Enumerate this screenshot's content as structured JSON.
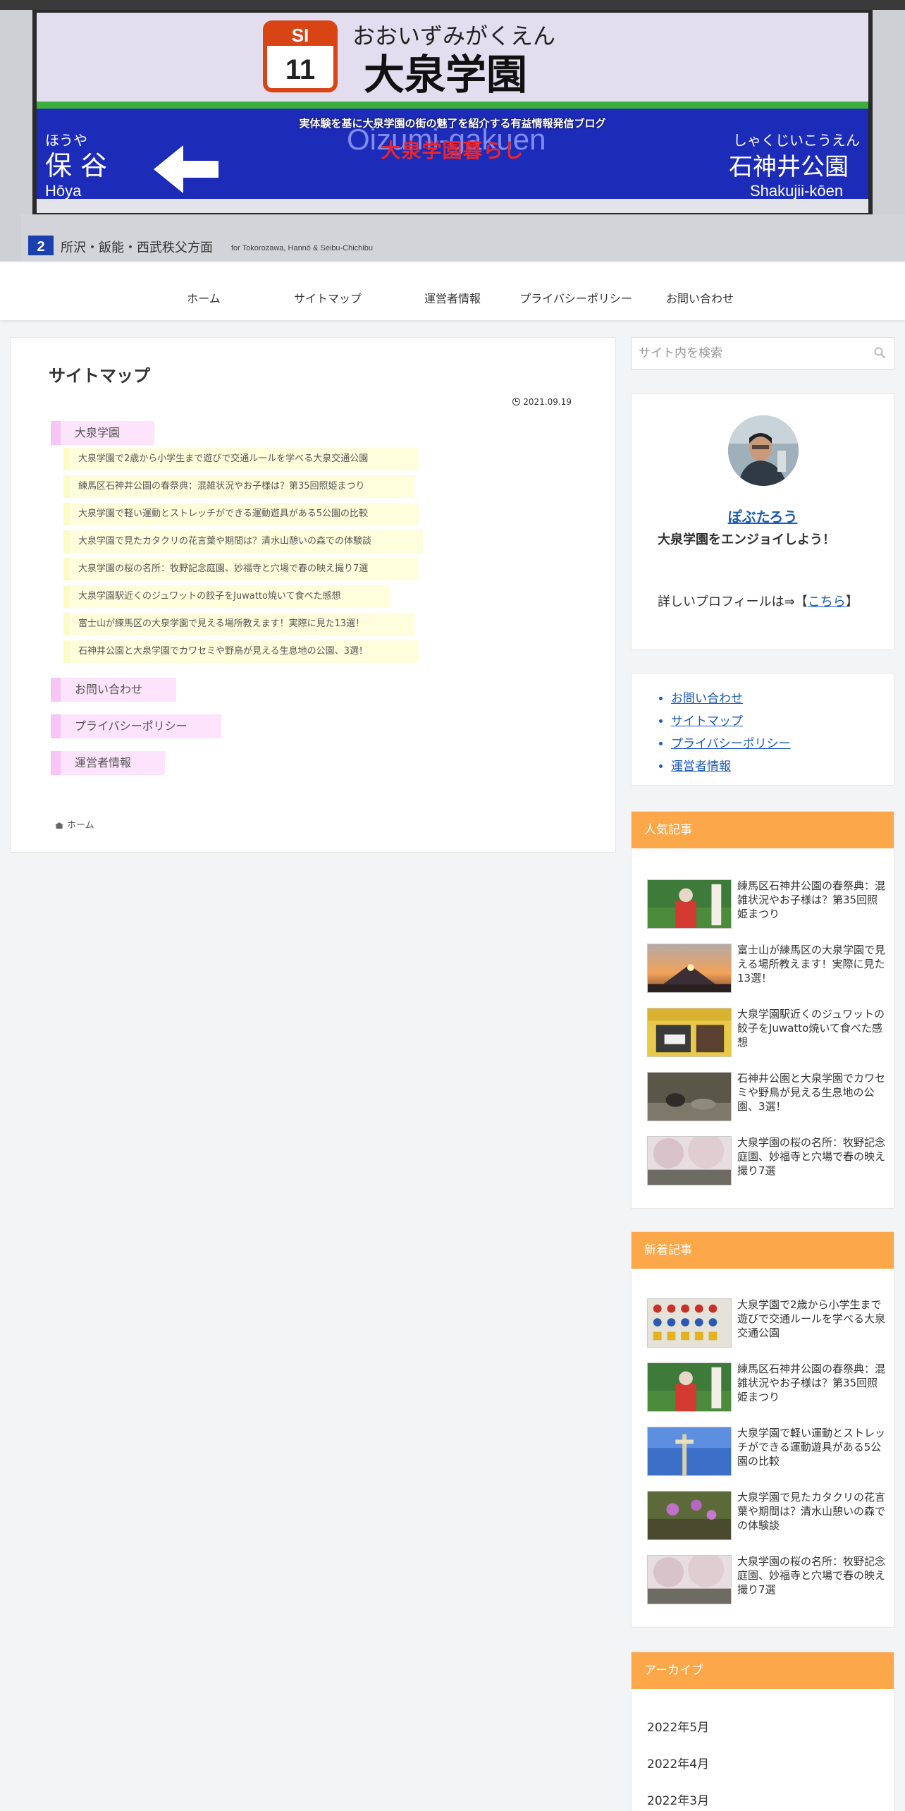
{
  "header": {
    "tagline": "実体験を基に大泉学園の街の魅了を紹介する有益情報発信ブログ",
    "site_title": "大泉学園暮らし",
    "photo_sign": {
      "station_number_line": "SI",
      "station_number": "11",
      "station_kana": "おおいずみがくえん",
      "station_kanji": "大泉学園",
      "station_roman": "Oizumi-gakuen",
      "left_kana": "ほうや",
      "left_kanji": "保 谷",
      "left_roman": "Hōya",
      "right_kana": "しゃくじいこうえん",
      "right_kanji": "石神井公園",
      "right_roman": "Shakujii-kōen",
      "platform_number": "2",
      "platform_text": "所沢・飯能・西武秩父方面",
      "platform_text_en": "for Tokorozawa, Hannō & Seibu-Chichibu"
    }
  },
  "nav": {
    "items": [
      "ホーム",
      "サイトマップ",
      "運営者情報",
      "プライバシーポリシー",
      "お問い合わせ"
    ]
  },
  "main": {
    "title": "サイトマップ",
    "date": "2021.09.19",
    "categories": [
      {
        "label": "大泉学園",
        "posts": [
          "大泉学園で2歳から小学生まで遊びで交通ルールを学べる大泉交通公園",
          "練馬区石神井公園の春祭典：混雑状況やお子様は？第35回照姫まつり",
          "大泉学園で軽い運動とストレッチができる運動遊具がある5公園の比較",
          "大泉学園で見たカタクリの花言葉や期間は？清水山憩いの森での体験談",
          "大泉学園の桜の名所：牧野記念庭園、妙福寺と穴場で春の映え撮り7選",
          "大泉学園駅近くのジュワットの餃子をJuwatto焼いて食べた感想",
          "富士山が練馬区の大泉学園で見える場所教えます！実際に見た13選！",
          "石神井公園と大泉学園でカワセミや野鳥が見える生息地の公園、3選！"
        ]
      }
    ],
    "pages": [
      "お問い合わせ",
      "プライバシーポリシー",
      "運営者情報"
    ],
    "breadcrumb": "ホーム"
  },
  "sidebar": {
    "search_placeholder": "サイト内を検索",
    "profile": {
      "name": "ぽぶたろう",
      "message": "大泉学園をエンジョイしよう！",
      "more_prefix": "詳しいプロフィールは⇒【",
      "more_link": "こちら",
      "more_suffix": "】"
    },
    "links": [
      "お問い合わせ",
      "サイトマップ",
      "プライバシーポリシー",
      "運営者情報"
    ],
    "popular": {
      "title": "人気記事",
      "items": [
        "練馬区石神井公園の春祭典：混雑状況やお子様は？第35回照姫まつり",
        "富士山が練馬区の大泉学園で見える場所教えます！実際に見た13選！",
        "大泉学園駅近くのジュワットの餃子をJuwatto焼いて食べた感想",
        "石神井公園と大泉学園でカワセミや野鳥が見える生息地の公園、3選！",
        "大泉学園の桜の名所：牧野記念庭園、妙福寺と穴場で春の映え撮り7選"
      ]
    },
    "recent": {
      "title": "新着記事",
      "items": [
        "大泉学園で2歳から小学生まで遊びで交通ルールを学べる大泉交通公園",
        "練馬区石神井公園の春祭典：混雑状況やお子様は？第35回照姫まつり",
        "大泉学園で軽い運動とストレッチができる運動遊具がある5公園の比較",
        "大泉学園で見たカタクリの花言葉や期間は？清水山憩いの森での体験談",
        "大泉学園の桜の名所：牧野記念庭園、妙福寺と穴場で春の映え撮り7選"
      ]
    },
    "archive": {
      "title": "アーカイブ",
      "items": [
        "2022年5月",
        "2022年4月",
        "2022年3月"
      ]
    }
  },
  "colors": {
    "widget_title_bg": "#fca84a",
    "link": "#1a5bb8",
    "site_title": "#e8242c",
    "category_bg": "#fde3fb",
    "post_link_bg": "#fefedc"
  }
}
